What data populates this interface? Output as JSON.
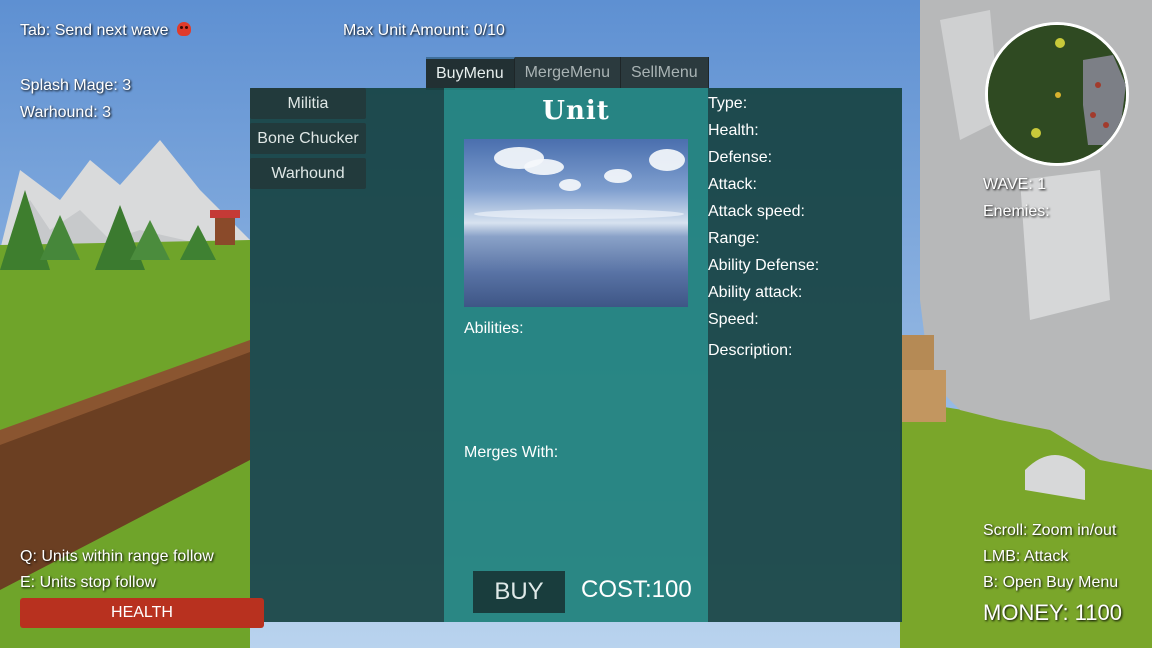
{
  "hud": {
    "send_wave": "Tab: Send next wave",
    "max_units": "Max Unit Amount: 0/10",
    "unit_counts": [
      "Splash Mage: 3",
      "Warhound: 3"
    ],
    "wave": "WAVE: 1",
    "enemies": "Enemies:",
    "hint_follow": "Q: Units within range follow",
    "hint_stop": "E: Units stop follow",
    "health_label": "HEALTH",
    "hint_zoom": "Scroll: Zoom in/out",
    "hint_attack": "LMB: Attack",
    "hint_buy": "B: Open Buy Menu",
    "money": "MONEY: 1100"
  },
  "tabs": [
    "BuyMenu",
    "MergeMenu",
    "SellMenu"
  ],
  "active_tab": "BuyMenu",
  "unit_list": [
    "Militia",
    "Bone Chucker",
    "Warhound"
  ],
  "unit_panel": {
    "title": "Unit",
    "abilities_label": "Abilities:",
    "merges_label": "Merges With:",
    "buy_label": "BUY",
    "cost": "COST:100"
  },
  "stats": [
    "Type:",
    "Health:",
    "Defense:",
    "Attack:",
    "Attack speed:",
    "Range:",
    "Ability Defense:",
    "Ability attack:",
    "Speed:",
    "Description:"
  ],
  "colors": {
    "panel_dark": "#184444",
    "panel_teal": "#23837e",
    "health_bar": "#b8311f",
    "skull": "#e03b2b"
  },
  "icons": {
    "skull": "skull-icon"
  }
}
